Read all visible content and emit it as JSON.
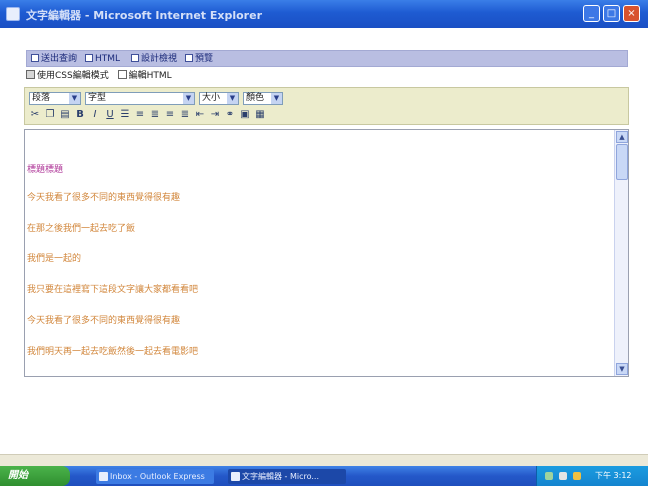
{
  "window": {
    "title": "文字編輯器 - Microsoft Internet Explorer",
    "minimize_glyph": "_",
    "maximize_glyph": "□",
    "close_glyph": "×"
  },
  "mode_bar": {
    "items": [
      {
        "label": "送出查詢"
      },
      {
        "label": "HTML"
      },
      {
        "label": "設計檢視"
      },
      {
        "label": "預覽"
      }
    ]
  },
  "options": {
    "use_css": {
      "label": "使用CSS編輯模式",
      "checked": true
    },
    "use_html": {
      "label": "編輯HTML",
      "checked": false
    }
  },
  "toolbar": {
    "format_select": "段落",
    "font_select": "字型",
    "size_select": "大小",
    "color_select": "顏色",
    "icons": [
      "cut-icon",
      "copy-icon",
      "paste-icon",
      "bold-icon",
      "italic-icon",
      "underline-icon",
      "ordered-list-icon",
      "unordered-list-icon",
      "align-left-icon",
      "align-center-icon",
      "align-right-icon",
      "outdent-icon",
      "indent-icon",
      "link-icon",
      "image-icon",
      "table-icon"
    ]
  },
  "editor": {
    "lines": [
      {
        "text": "標題標題",
        "color": "#b03a9a"
      },
      {
        "text": "今天我看了很多不同的東西覺得很有趣",
        "color": "#d2873c"
      },
      {
        "text": "在那之後我們一起去吃了飯",
        "color": "#d2873c"
      },
      {
        "text": "我們是一起的",
        "color": "#d2873c"
      },
      {
        "text": "我只要在這裡寫下這段文字讓大家都看看吧",
        "color": "#d2873c"
      },
      {
        "text": "今天我看了很多不同的東西覺得很有趣",
        "color": "#d2873c"
      },
      {
        "text": "我們明天再一起去吃飯然後一起去看電影吧",
        "color": "#d2873c"
      }
    ]
  },
  "taskbar": {
    "start_label": "開始",
    "tasks": [
      {
        "label": "Inbox - Outlook Express"
      },
      {
        "label": "文字編輯器 - Micro..."
      }
    ],
    "clock": "下午 3:12"
  },
  "colors": {
    "titlebar": "#1e5bd2",
    "modebar": "#b9bee2",
    "toolbar": "#ececcc",
    "heading_text": "#b03a9a",
    "body_text": "#d2873c"
  }
}
